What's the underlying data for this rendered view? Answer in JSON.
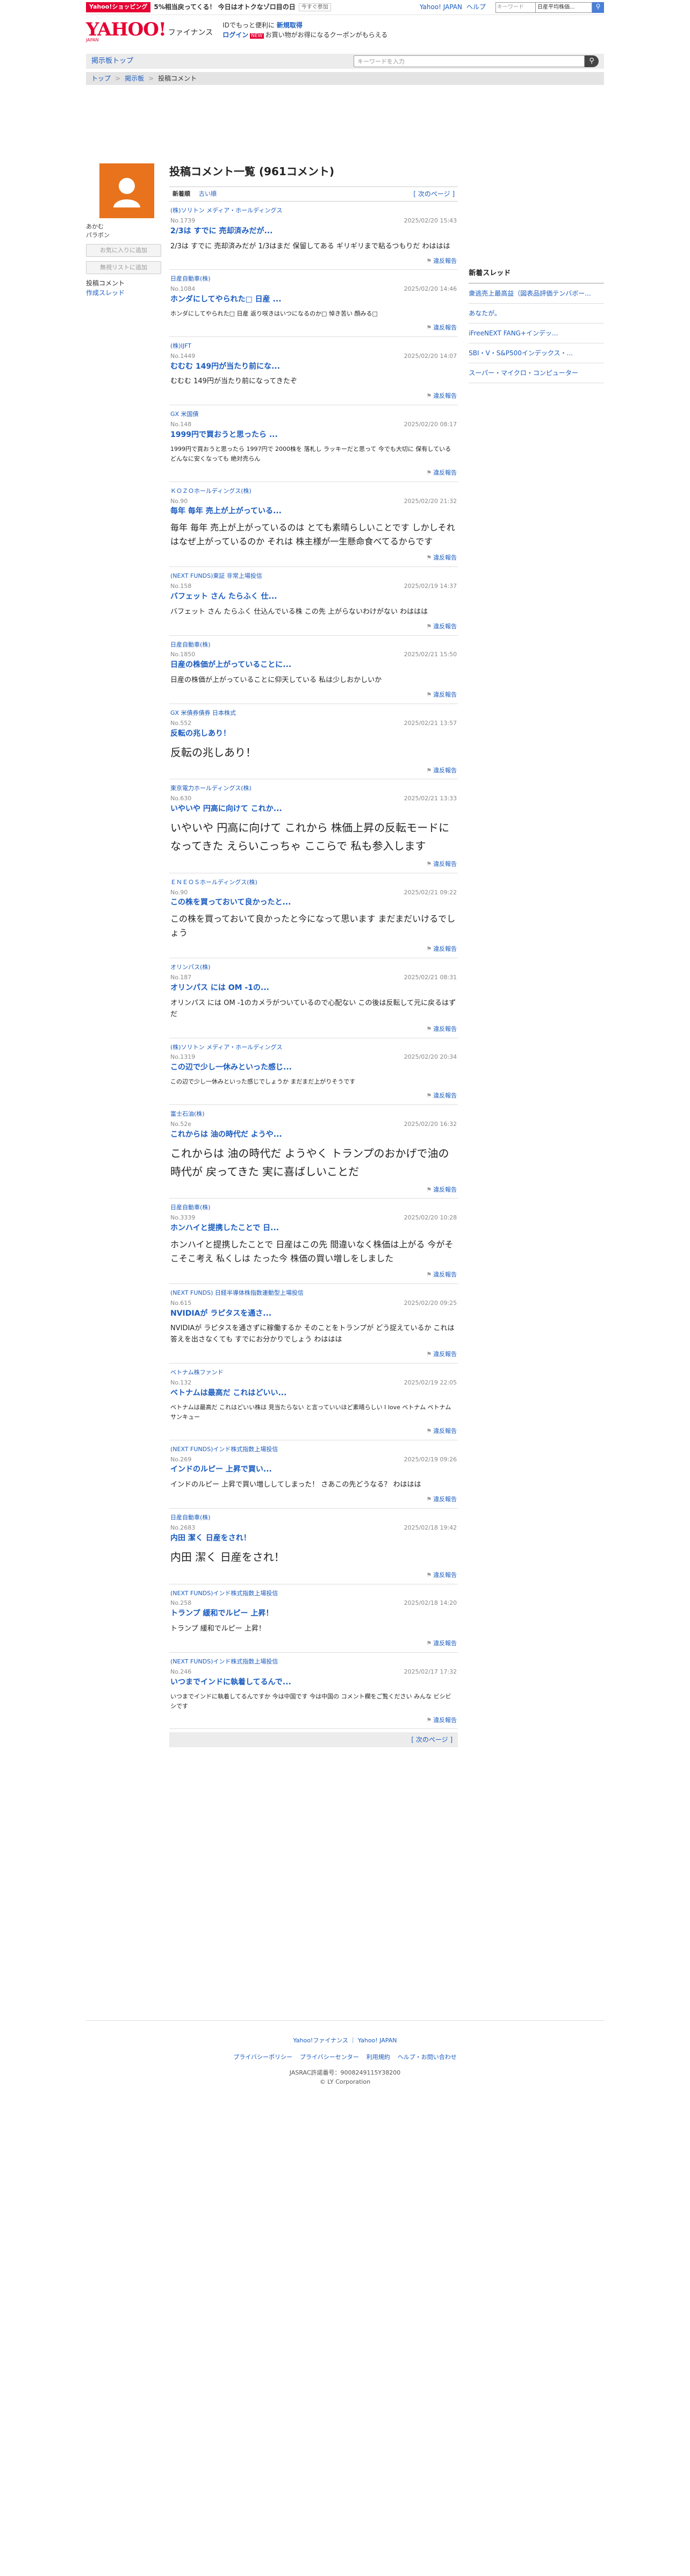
{
  "topbar": {
    "shop_badge": "Yahoo!ショッピング",
    "promo": "5%相当戻ってくる！ 今日はオトクなゾロ目の日",
    "promo_small": "今すぐ参加",
    "links": [
      "Yahoo! JAPAN",
      "ヘルプ"
    ],
    "search_placeholder": "キーワード",
    "search_select": "日産平均株価...",
    "search_icon": "search-icon"
  },
  "header": {
    "logo": "YAHOO!",
    "logo_sub": "ファイナンス",
    "logo_japan": "JAPAN",
    "info_line1_pre": "IDでもっと便利に",
    "info_line1_link": "新規取得",
    "info_login": "ログイン",
    "info_new": "NEW",
    "info_line2_rest": "お買い物がお得になるクーポンがもらえる"
  },
  "nav": {
    "board_top": "掲示板トップ",
    "search_placeholder": "キーワードを入力",
    "search_icon": "search-icon"
  },
  "breadcrumb": [
    "トップ",
    "掲示板",
    "投稿コメント"
  ],
  "left": {
    "user_line1": "あかむ",
    "user_line2": "パラボン",
    "btn_favorite": "お気に入りに追加",
    "btn_block": "無視リストに追加",
    "link_comments": "投稿コメント",
    "link_threads": "作成スレッド"
  },
  "center": {
    "title": "投稿コメント一覧 (961コメント)",
    "tab_new": "新着順",
    "tab_old": "古い順",
    "next": "[ 次のページ ]",
    "report": "違反報告"
  },
  "posts": [
    {
      "stock": "(株)ソリトン メディア・ホールディングス",
      "no": "No.1739",
      "date": "2025/02/20 15:43",
      "title": "2/3は すでに 売却済みだが...",
      "body": "2/3は すでに 売却済みだが 1/3はまだ 保留してある ギリギリまで粘るつもりだ わははは",
      "size": "f1"
    },
    {
      "stock": "日産自動車(株)",
      "no": "No.1084",
      "date": "2025/02/20 14:46",
      "title": "ホンダにしてやられた□ 日産 ...",
      "body": "ホンダにしてやられた□ 日産 返り咲きはいつになるのか□ 悼き苦い 顔みる□",
      "size": "f0"
    },
    {
      "stock": "(株)IJFT",
      "no": "No.1449",
      "date": "2025/02/20 14:07",
      "title": "むむむ 149円が当たり前にな...",
      "body": "むむむ 149円が当たり前になってきたぞ",
      "size": "f1"
    },
    {
      "stock": "GX 米国債",
      "no": "No.148",
      "date": "2025/02/20 08:17",
      "title": "1999円で買おうと思ったら ...",
      "body": "1999円で買おうと思ったら 1997円で 2000株を 落札し ラッキーだと思って 今でも大切に 保有している どんなに安くなっても 絶対売らん",
      "size": "f0"
    },
    {
      "stock": "ＫＯＺＯホールディングス(株)",
      "no": "No.90",
      "date": "2025/02/20 21:32",
      "title": "毎年 毎年 売上が上がっている...",
      "body": "毎年 毎年 売上が上がっているのは とても素晴らしいことです しかしそれはなぜ上がっているのか それは 株主様が一生懸命食べてるからです",
      "size": "f2"
    },
    {
      "stock": "(NEXT FUNDS)東証 非常上場投信",
      "no": "No.158",
      "date": "2025/02/19 14:37",
      "title": "バフェット さん たらふく 仕...",
      "body": "バフェット さん たらふく 仕込んでいる株 この先 上がらないわけがない わははは",
      "size": "f1"
    },
    {
      "stock": "日産自動車(株)",
      "no": "No.1850",
      "date": "2025/02/21 15:50",
      "title": "日産の株価が上がっていることに...",
      "body": "日産の株価が上がっていることに仰天している 私は少しおかしいか",
      "size": "f1"
    },
    {
      "stock": "GX 米債券債券 日本株式",
      "no": "No.552",
      "date": "2025/02/21 13:57",
      "title": "反転の兆しあり！",
      "body": "反転の兆しあり！",
      "size": "f3"
    },
    {
      "stock": "東京電力ホールディングス(株)",
      "no": "No.630",
      "date": "2025/02/21 13:33",
      "title": "いやいや 円高に向けて これか...",
      "body": "いやいや 円高に向けて これから 株価上昇の反転モードになってきた えらいこっちゃ ここらで 私も参入します",
      "size": "f3"
    },
    {
      "stock": "ＥＮＥＯＳホールディングス(株)",
      "no": "No.90",
      "date": "2025/02/21 09:22",
      "title": "この株を買っておいて良かったと...",
      "body": "この株を買っておいて良かったと今になって思います まだまだいけるでしょう",
      "size": "f2"
    },
    {
      "stock": "オリンパス(株)",
      "no": "No.187",
      "date": "2025/02/21 08:31",
      "title": "オリンパス には OM -1の...",
      "body": "オリンパス には OM -1のカメラがついているので心配ない この後は反転して元に戻るはずだ",
      "size": "f1"
    },
    {
      "stock": "(株)ソリトン メディア・ホールディングス",
      "no": "No.1319",
      "date": "2025/02/20 20:34",
      "title": "この辺で少し一休みといった感じ...",
      "body": "この辺で少し一休みといった感じでしょうか まだまだ上がりそうです",
      "size": "f0"
    },
    {
      "stock": "富士石油(株)",
      "no": "No.52e",
      "date": "2025/02/20 16:32",
      "title": "これからは 油の時代だ ようや...",
      "body": "これからは 油の時代だ ようやく トランプのおかげで油の時代が 戻ってきた 実に喜ばしいことだ",
      "size": "f3"
    },
    {
      "stock": "日産自動車(株)",
      "no": "No.3339",
      "date": "2025/02/20 10:28",
      "title": "ホンハイと提携したことで 日...",
      "body": "ホンハイと提携したことで 日産はこの先 間違いなく株価は上がる 今がそこそこ考え 私くしは たった今 株価の買い増しをしました",
      "size": "f2"
    },
    {
      "stock": "(NEXT FUNDS) 日経半導体株指数連動型上場投信",
      "no": "No.615",
      "date": "2025/02/20 09:25",
      "title": "NVIDIAが ラピタスを通さ...",
      "body": "NVIDIAが ラピタスを通さずに稼働するか そのことをトランプが どう捉えているか これは答えを出さなくても すでにお分かりでしょう わははは",
      "size": "f1"
    },
    {
      "stock": "ベトナム株ファンド",
      "no": "No.132",
      "date": "2025/02/19 22:05",
      "title": "ベトナムは最高だ これはどいい...",
      "body": "ベトナムは最高だ これはどいい株は 見当たらない と言っていいほど素晴らしい I love ベトナム ベトナム サンキュー",
      "size": "f0"
    },
    {
      "stock": "(NEXT FUNDS)インド株式指数上場投信",
      "no": "No.269",
      "date": "2025/02/19 09:26",
      "title": "インドのルピー 上昇で買い...",
      "body": "インドのルピー 上昇で買い増ししてしまった！ さあこの先どうなる？ わははは",
      "size": "f1"
    },
    {
      "stock": "日産自動車(株)",
      "no": "No.2683",
      "date": "2025/02/18 19:42",
      "title": "内田 潔く 日産をされ！",
      "body": "内田 潔く 日産をされ！",
      "size": "f3"
    },
    {
      "stock": "(NEXT FUNDS)インド株式指数上場投信",
      "no": "No.258",
      "date": "2025/02/18 14:20",
      "title": "トランプ 緩和でルピー 上昇！",
      "body": "トランプ 緩和でルピー 上昇！",
      "size": "f1"
    },
    {
      "stock": "(NEXT FUNDS)インド株式指数上場投信",
      "no": "No.246",
      "date": "2025/02/17 17:32",
      "title": "いつまでインドに執着してるんで...",
      "body": "いつまでインドに執着してるんですか 今は中国です 今は中国の コメント欄をご覧ください みんな ビシビシです",
      "size": "f0"
    }
  ],
  "right": {
    "heading": "新着スレッド",
    "threads": [
      "衆逃売上最高益（図表品評価テンバボー...",
      "あなたが。",
      "iFreeNEXT FANG+インデッ...",
      "SBI・V・S&P500インデックス・...",
      "スーパー・マイクロ・コンピューター"
    ]
  },
  "footer": {
    "links1": [
      "Yahoo!ファイナンス",
      "Yahoo! JAPAN"
    ],
    "links2": [
      "プライバシーポリシー",
      "プライバシーセンター",
      "利用規約",
      "ヘルプ・お問い合わせ"
    ],
    "line3": "JASRAC許諾番号：9008249115Y38200",
    "line4": "© LY Corporation"
  }
}
